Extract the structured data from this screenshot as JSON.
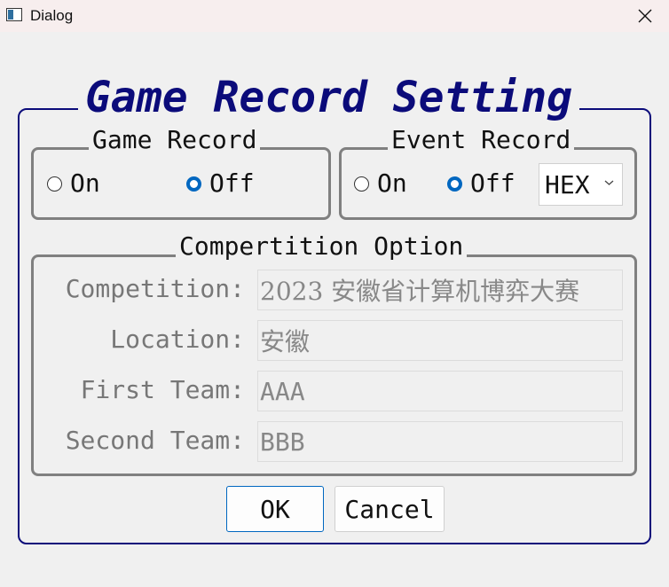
{
  "window": {
    "title": "Dialog",
    "icons": {
      "app": "window-icon",
      "close": "close-icon"
    }
  },
  "main": {
    "title": "Game Record Setting",
    "accent_color": "#0b0b7a"
  },
  "game_record": {
    "title": "Game Record",
    "on_label": "On",
    "off_label": "Off",
    "selected": "Off"
  },
  "event_record": {
    "title": "Event Record",
    "on_label": "On",
    "off_label": "Off",
    "selected": "Off",
    "format": "HEX"
  },
  "competition": {
    "title": "Compertition Option",
    "fields": [
      {
        "label": "Competition:",
        "value": "2023 安徽省计算机博弈大赛"
      },
      {
        "label": "Location:",
        "value": "安徽"
      },
      {
        "label": "First Team:",
        "value": "AAA"
      },
      {
        "label": "Second Team:",
        "value": "BBB"
      }
    ]
  },
  "buttons": {
    "ok": "OK",
    "cancel": "Cancel"
  }
}
